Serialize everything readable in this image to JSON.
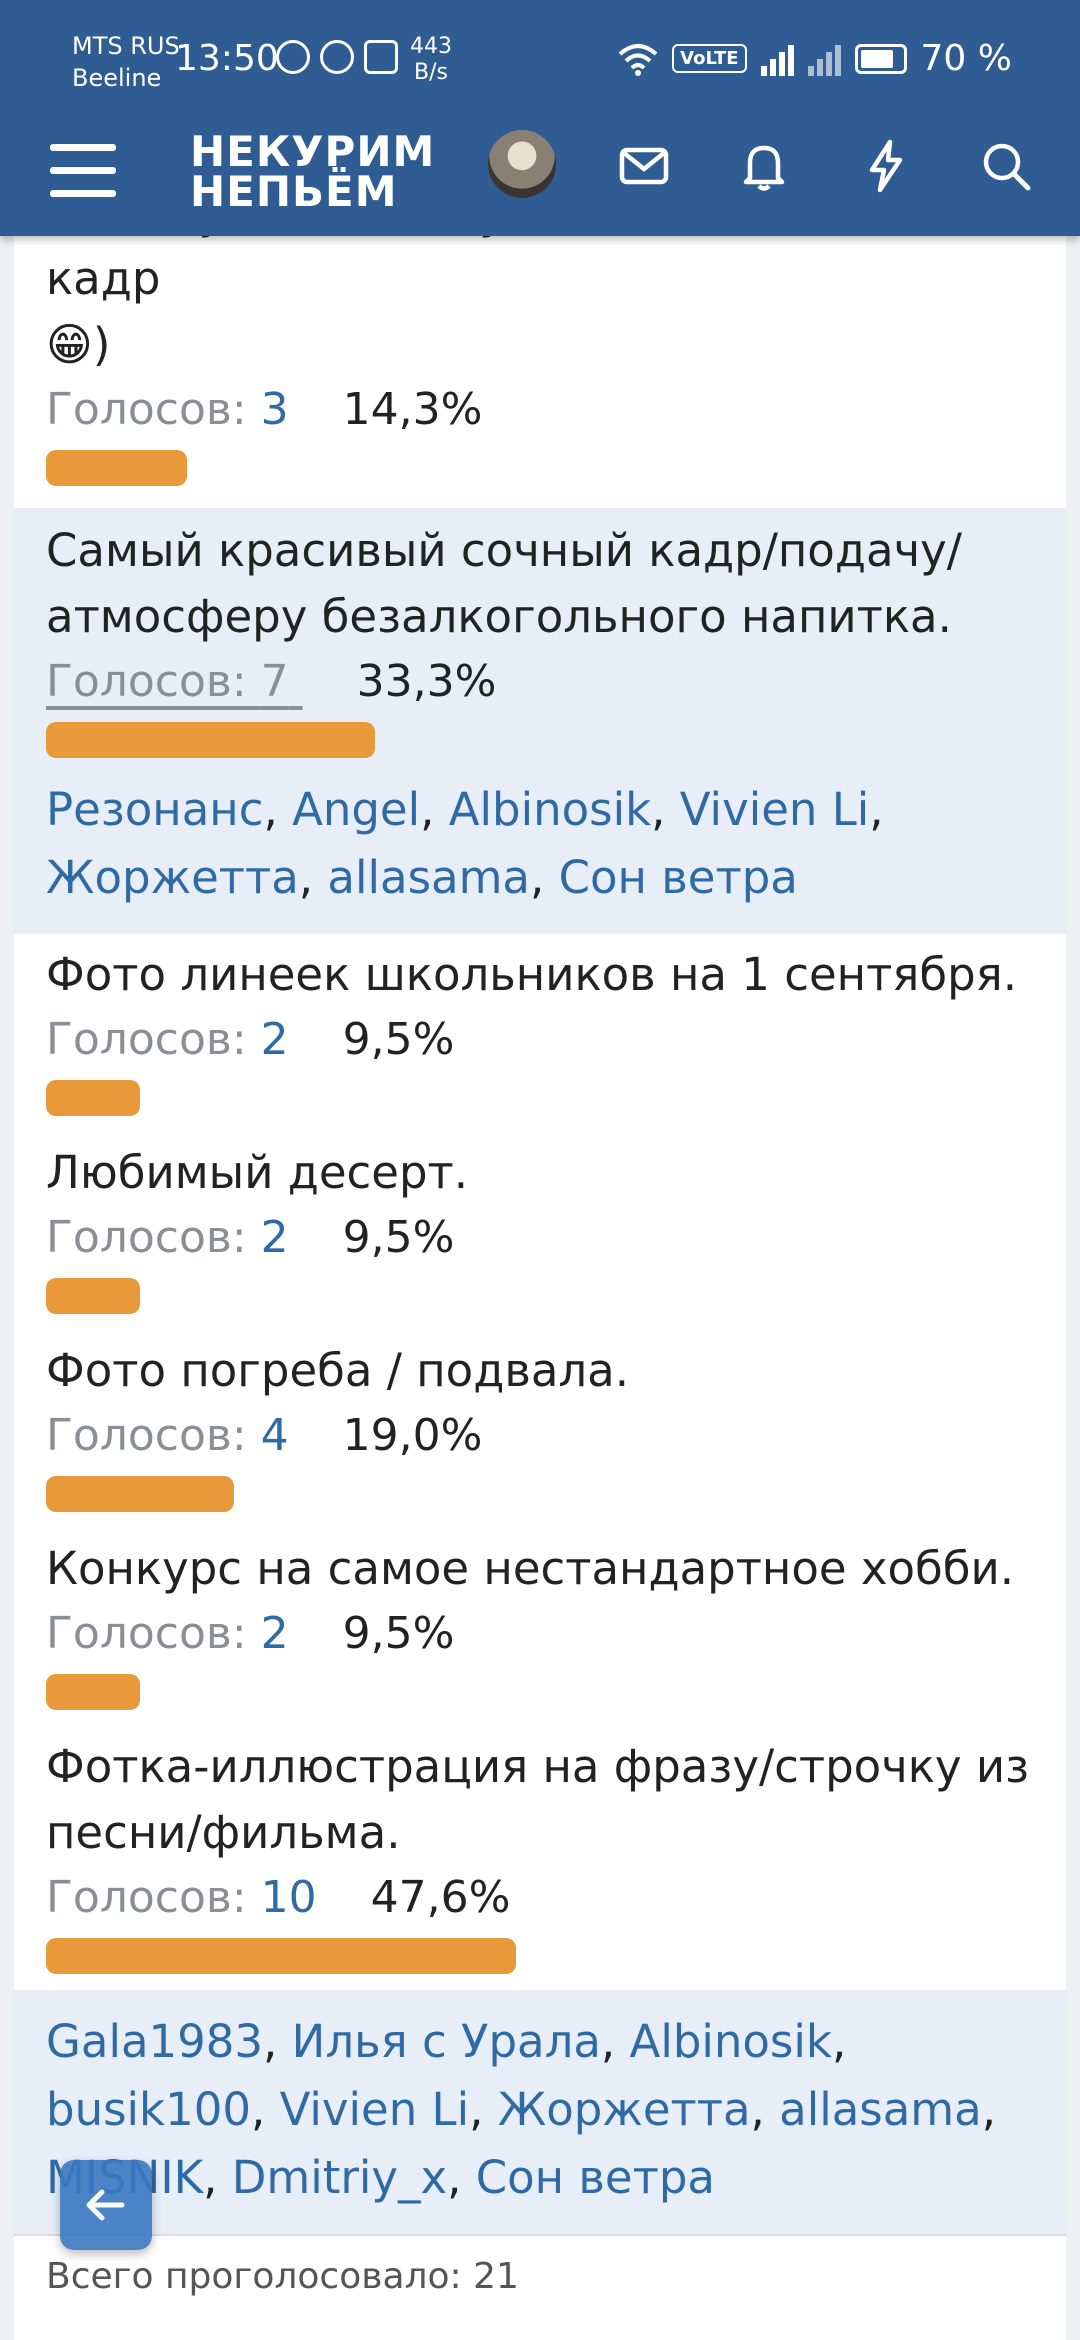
{
  "status": {
    "carrier1": "MTS RUS",
    "carrier2": "Beeline",
    "time": "13:50",
    "speed_value": "443",
    "speed_unit": "B/s",
    "volte": "VoLTE",
    "battery": "70 %"
  },
  "header": {
    "logo_line1": "НЕКУРИМ",
    "logo_line2": "НЕПЬЁМ"
  },
  "poll": {
    "votes_label": "Голосов: ",
    "options": [
      {
        "text_partial": "покажу (самый неудачный смешной кадр",
        "text_tail": ")",
        "emoji": "😁",
        "votes": "3",
        "percent": "14,3%",
        "fraction": 0.143
      },
      {
        "text": "Самый красивый сочный кадр/подачу/атмосферу безалкогольного напитка.",
        "votes": "7",
        "percent": "33,3%",
        "fraction": 0.333,
        "voters": [
          "Резонанс",
          "Angel",
          "Albinosik",
          "Vivien Li",
          "Жоржетта",
          "allasama",
          "Сон ветра"
        ]
      },
      {
        "text": "Фото линеек школьников на 1 сентября.",
        "votes": "2",
        "percent": "9,5%",
        "fraction": 0.095
      },
      {
        "text": "Любимый десерт.",
        "votes": "2",
        "percent": "9,5%",
        "fraction": 0.095
      },
      {
        "text": "Фото погреба / подвала.",
        "votes": "4",
        "percent": "19,0%",
        "fraction": 0.19
      },
      {
        "text": "Конкурс на самое нестандартное хобби.",
        "votes": "2",
        "percent": "9,5%",
        "fraction": 0.095
      },
      {
        "text": "Фотка-иллюстрация на фразу/строчку из песни/фильма.",
        "votes": "10",
        "percent": "47,6%",
        "fraction": 0.476,
        "voters": [
          "Gala1983",
          "Илья с Урала",
          "Albinosik",
          "busik100",
          "Vivien Li",
          "Жоржетта",
          "allasama",
          "MISNIK",
          "Dmitriy_x",
          "Сон ветра"
        ]
      }
    ],
    "total_label": "Всего проголосовало: 21"
  },
  "icons": {
    "menu": "hamburger-icon",
    "mail": "mail-icon",
    "bell": "bell-icon",
    "bolt": "bolt-icon",
    "search": "search-icon",
    "back": "arrow-left-icon"
  },
  "colors": {
    "header_bg": "#2f5c92",
    "bar": "#e89a3a",
    "link": "#2f6aa5",
    "highlight_bg": "#e7eef8"
  }
}
